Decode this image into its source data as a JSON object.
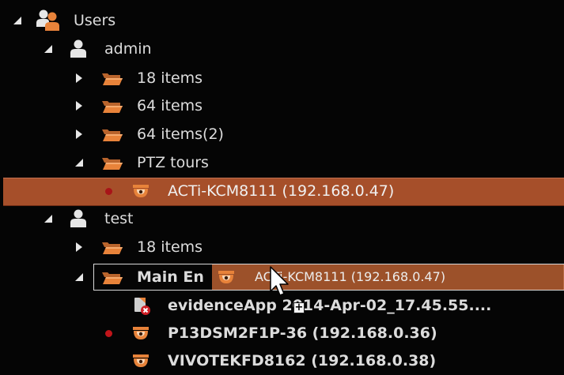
{
  "tree": {
    "users": {
      "label": "Users"
    },
    "admin": {
      "label": "admin"
    },
    "admin_items_18": {
      "label": "18 items"
    },
    "admin_items_64": {
      "label": "64 items"
    },
    "admin_items_64_2": {
      "label": "64 items(2)"
    },
    "ptz_tours": {
      "label": "PTZ tours"
    },
    "ptz_camera": {
      "label": "ACTi-KCM8111 (192.168.0.47)"
    },
    "test": {
      "label": "test"
    },
    "test_items_18": {
      "label": "18 items"
    },
    "main_entrance": {
      "label": "Main En"
    },
    "evidence_file": {
      "label": "evidenceApp  2014-Apr-02_17.45.55...."
    },
    "camera_p13": {
      "label": "P13DSM2F1P-36 (192.168.0.36)"
    },
    "camera_vivotek": {
      "label": "VIVOTEKFD8162 (192.168.0.38)"
    }
  },
  "drag": {
    "ghost_label": "ACTi-KCM8111 (192.168.0.47)",
    "copy_indicator": "+"
  },
  "colors": {
    "background": "#050505",
    "selection": "#a64f2a",
    "drag_ghost": "#b25c30",
    "folder": "#e8833a",
    "camera": "#e8833a",
    "status_dot": "#c0151a",
    "text": "#dcdcdc"
  }
}
